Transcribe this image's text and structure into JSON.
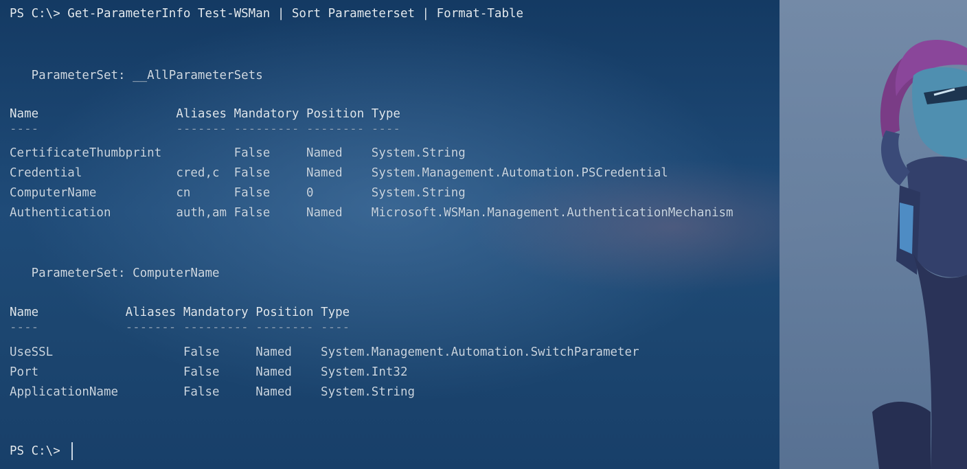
{
  "command_line": "PS C:\\> Get-ParameterInfo Test-WSMan | Sort Parameterset | Format-Table",
  "sections": [
    {
      "header": "   ParameterSet: __AllParameterSets",
      "columns": "Name                   Aliases Mandatory Position Type",
      "dashes": "----                   ------- --------- -------- ----",
      "rows": [
        "CertificateThumbprint          False     Named    System.String",
        "Credential             cred,c  False     Named    System.Management.Automation.PSCredential",
        "ComputerName           cn      False     0        System.String",
        "Authentication         auth,am False     Named    Microsoft.WSMan.Management.AuthenticationMechanism"
      ]
    },
    {
      "header": "   ParameterSet: ComputerName",
      "columns": "Name            Aliases Mandatory Position Type",
      "dashes": "----            ------- --------- -------- ----",
      "rows": [
        "UseSSL                  False     Named    System.Management.Automation.SwitchParameter",
        "Port                    False     Named    System.Int32",
        "ApplicationName         False     Named    System.String"
      ]
    }
  ],
  "final_prompt": "PS C:\\> ",
  "colors": {
    "background": "#1e4770",
    "text": "#d8e2ec",
    "right_panel": "#7c91ad"
  },
  "icons": {
    "character": "terminal-theme-character-illustration"
  }
}
